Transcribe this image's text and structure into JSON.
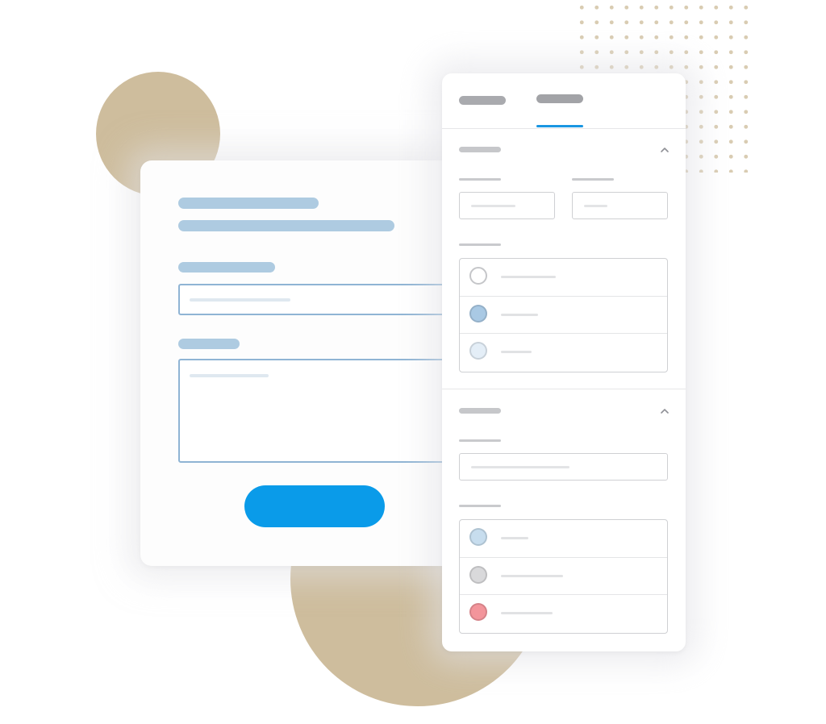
{
  "colors": {
    "tan": "#cebd9d",
    "dot": "#d9ccb2",
    "form_bar": "#aecbe1",
    "form_field_border": "#8fb4d4",
    "form_field_line": "#dfe8f0",
    "submit": "#0a9be9",
    "tab_inactive": "#a9aaae",
    "tab_active": "#a2a3a7",
    "tab_underline": "#1a96e2",
    "radio_empty": "#ffffff",
    "radio_blue": "#a9c9e4",
    "radio_pale_blue": "#e4eef7",
    "radio_light_blue": "#c7ddee",
    "radio_gray": "#d9d9db",
    "radio_red": "#f3959b"
  },
  "icons": {
    "section_toggle": "chevron-up-icon"
  },
  "panel": {
    "active_tab_index": 1,
    "sections": [
      {
        "expanded": true,
        "options": [
          "empty",
          "blue",
          "pale-blue"
        ]
      },
      {
        "expanded": true,
        "options": [
          "light-blue",
          "gray",
          "red"
        ]
      }
    ]
  }
}
